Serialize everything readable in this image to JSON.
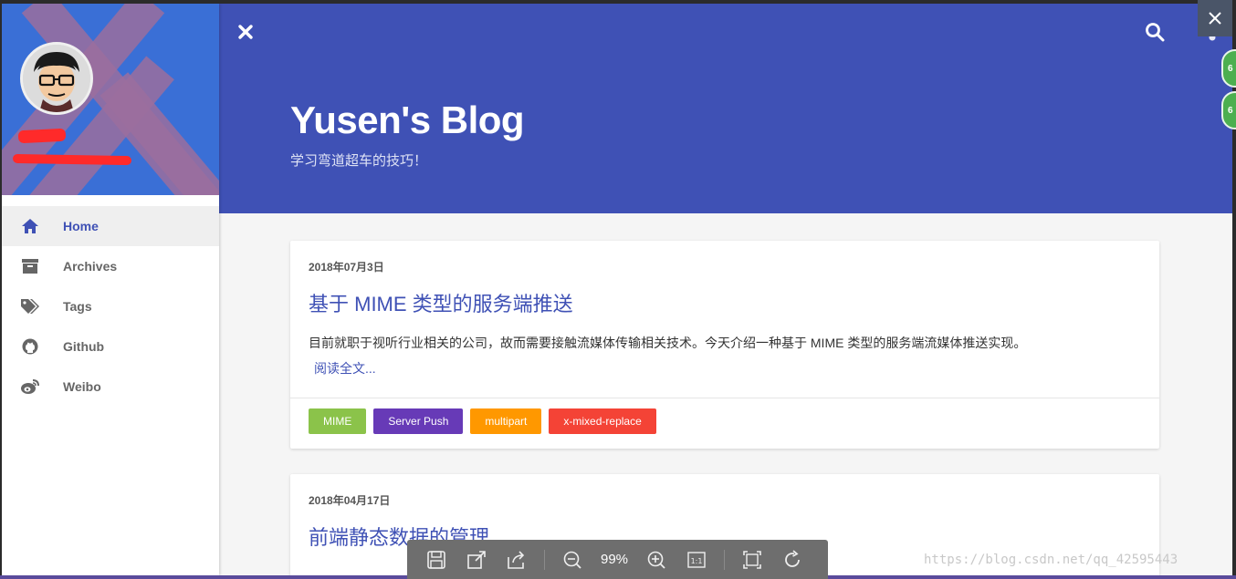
{
  "sidebar": {
    "items": [
      {
        "label": "Home",
        "icon": "home-icon",
        "active": true
      },
      {
        "label": "Archives",
        "icon": "archive-icon",
        "active": false
      },
      {
        "label": "Tags",
        "icon": "tags-icon",
        "active": false
      },
      {
        "label": "Github",
        "icon": "github-icon",
        "active": false
      },
      {
        "label": "Weibo",
        "icon": "weibo-icon",
        "active": false
      }
    ]
  },
  "header": {
    "title": "Yusen's Blog",
    "subtitle": "学习弯道超车的技巧！"
  },
  "posts": [
    {
      "date": "2018年07月3日",
      "title": "基于 MIME 类型的服务端推送",
      "excerpt": "目前就职于视听行业相关的公司，故而需要接触流媒体传输相关技术。今天介绍一种基于 MIME 类型的服务端流媒体推送实现。",
      "more": "阅读全文...",
      "tags": [
        {
          "label": "MIME",
          "color": "#8bc34a"
        },
        {
          "label": "Server Push",
          "color": "#673ab7"
        },
        {
          "label": "multipart",
          "color": "#ff9800"
        },
        {
          "label": "x-mixed-replace",
          "color": "#f44336"
        }
      ]
    },
    {
      "date": "2018年04月17日",
      "title": "前端静态数据的管理"
    }
  ],
  "viewer": {
    "zoom": "99%",
    "actual_size_label": "1:1",
    "badges": [
      "6",
      "6"
    ]
  },
  "watermark": "https://blog.csdn.net/qq_42595443",
  "colors": {
    "primary": "#3f51b5",
    "sidebar_header": "#3a6fd6"
  }
}
